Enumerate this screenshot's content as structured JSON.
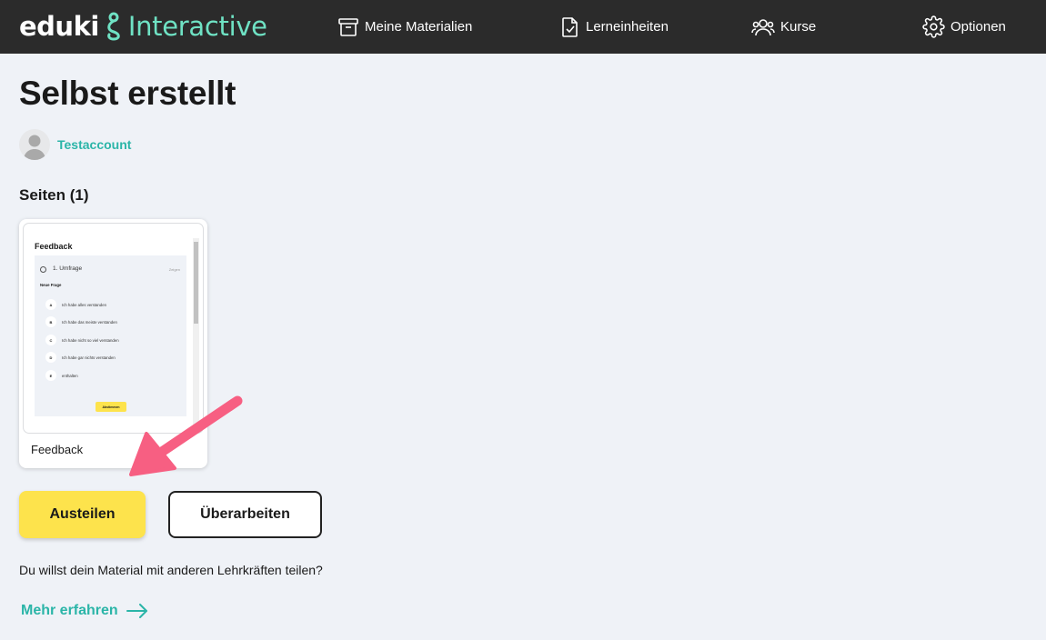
{
  "header": {
    "logo_eduki": "eduki",
    "logo_interactive": "Interactive",
    "nav": [
      {
        "label": "Meine Materialien",
        "icon": "archive-box-icon"
      },
      {
        "label": "Lerneinheiten",
        "icon": "document-check-icon"
      },
      {
        "label": "Kurse",
        "icon": "users-icon"
      },
      {
        "label": "Optionen",
        "icon": "gear-icon"
      }
    ]
  },
  "main": {
    "title": "Selbst erstellt",
    "author": "Testaccount",
    "section_title": "Seiten (1)",
    "page_card": {
      "label": "Feedback",
      "preview": {
        "title": "Feedback",
        "question_type": "1. Umfrage",
        "toggle_label": "Zeigen",
        "question": "Neue Frage",
        "options": [
          {
            "letter": "A",
            "text": "Ich habe alles verstanden"
          },
          {
            "letter": "B",
            "text": "Ich habe das meiste verstanden"
          },
          {
            "letter": "C",
            "text": "Ich habe nicht so viel verstanden"
          },
          {
            "letter": "D",
            "text": "Ich habe gar nichts verstanden"
          },
          {
            "letter": "E",
            "text": "enthalten"
          }
        ],
        "submit_label": "Abstimmen"
      }
    },
    "share_button": "Austeilen",
    "edit_button": "Überarbeiten",
    "share_info": "Du willst dein Material mit anderen Lehrkräften teilen?",
    "more_link": "Mehr erfahren"
  },
  "colors": {
    "header_bg": "#2b2b2b",
    "accent_teal": "#2bb5a8",
    "logo_interactive": "#6fe2c4",
    "primary_yellow": "#fde34c",
    "annotation_arrow": "#f75f82"
  }
}
